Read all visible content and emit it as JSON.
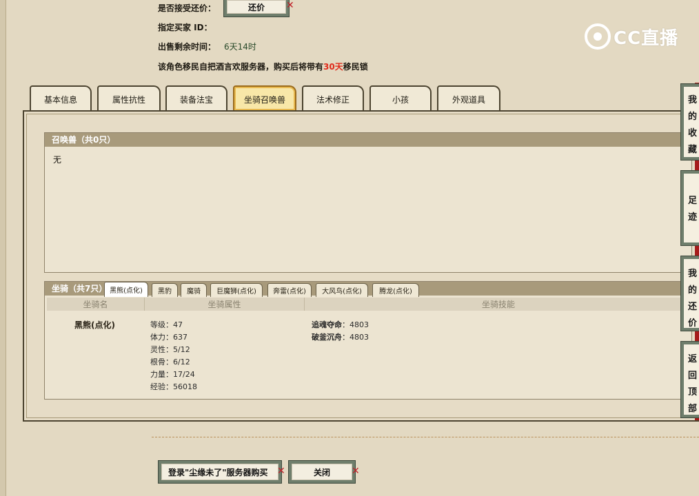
{
  "header": {
    "accept_counter_label": "是否接受还价：",
    "counter_button": "还价",
    "buyer_id_label": "指定买家 ID：",
    "time_label": "出售剩余时间：",
    "time_value": "6天14时",
    "warning_prefix": "该角色移民自把酒言欢服务器，购买后将带有",
    "warning_days": "30天",
    "warning_suffix": "移民锁"
  },
  "watermark": {
    "text": "CC直播"
  },
  "tabs": [
    "基本信息",
    "属性抗性",
    "装备法宝",
    "坐骑召唤兽",
    "法术修正",
    "小孩",
    "外观道具"
  ],
  "active_tab": "坐骑召唤兽",
  "summon": {
    "title": "召唤兽（共0只）",
    "content": "无"
  },
  "mount": {
    "title": "坐骑（共7只）",
    "tabs": [
      "黑熊(点化)",
      "黑豹",
      "魔骑",
      "巨魔狮(点化)",
      "奔雷(点化)",
      "大风鸟(点化)",
      "腾龙(点化)"
    ],
    "columns": [
      "坐骑名",
      "坐骑属性",
      "坐骑技能"
    ],
    "name": "黑熊(点化)",
    "stats": [
      "等级：47",
      "体力：637",
      "灵性：5/12",
      "根骨：6/12",
      "力量：17/24",
      "经验：56018"
    ],
    "skills": [
      {
        "name": "追魂夺命",
        "value": "：4803"
      },
      {
        "name": "破釜沉舟",
        "value": "：4803"
      }
    ]
  },
  "buttons": {
    "login_buy": "登录\"尘缘未了\"服务器购买",
    "close": "关闭"
  },
  "side_nav": [
    "我的收藏",
    "足迹",
    "我的还价",
    "返回顶部"
  ],
  "colors": {
    "accent_red": "#e02a1a",
    "tab_active": "#f8e7a8"
  }
}
